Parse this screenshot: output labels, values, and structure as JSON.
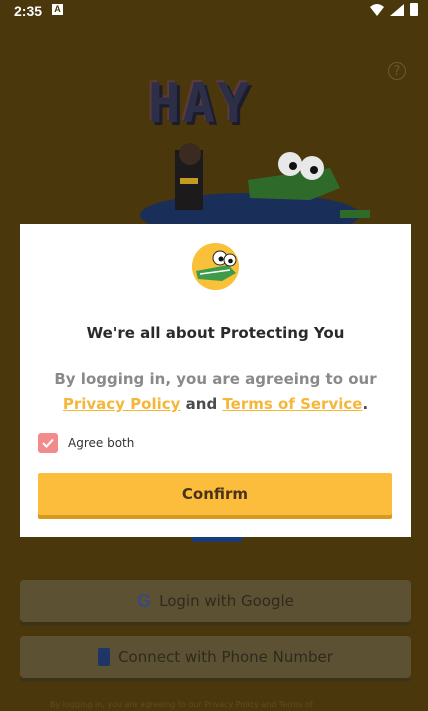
{
  "status_bar": {
    "time": "2:35",
    "notification": "A"
  },
  "background": {
    "logo_text": "HAY",
    "help_icon": "?",
    "google_button": "Login with Google",
    "phone_button": "Connect with Phone Number",
    "bottom_text": "By logging in, you are agreeing to our Privacy Policy and Terms of"
  },
  "modal": {
    "title": "We're all about Protecting You",
    "consent_prefix": "By logging in, you are agreeing to our",
    "privacy_link": "Privacy Policy",
    "and": "and",
    "terms_link": "Terms of Service",
    "period": ".",
    "agree_label": "Agree both",
    "agree_checked": true,
    "confirm_label": "Confirm"
  },
  "colors": {
    "accent": "#fbbd3b",
    "checkbox": "#f28c8c",
    "dim_background": "#4a370b"
  }
}
